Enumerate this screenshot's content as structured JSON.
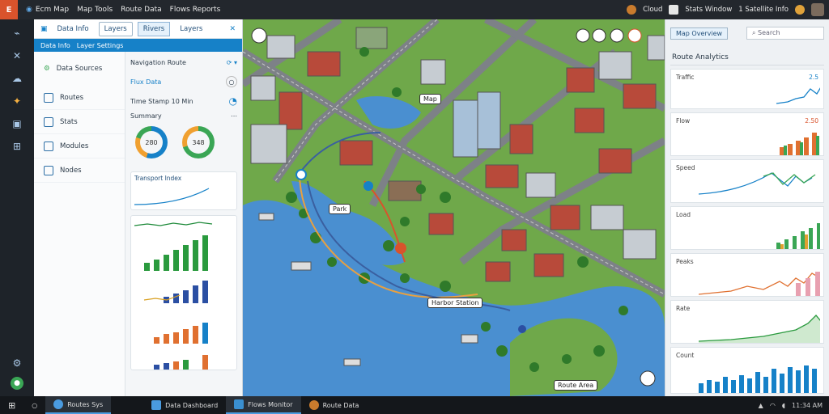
{
  "topbar": {
    "logo": "E",
    "items": [
      "Ecm Map",
      "Map Tools",
      "Route Data",
      "Flows Reports"
    ],
    "right_items": [
      "Cloud",
      "Stats Window",
      "1 Satellite Info"
    ]
  },
  "left_panel": {
    "tabs": [
      "Data Info",
      "Layers",
      "Rivers",
      "Layers"
    ],
    "bar_items": [
      "Data Info",
      "Layer Settings"
    ],
    "nav_items": [
      "Data Sources",
      "Routes",
      "Stats",
      "Modules",
      "Nodes"
    ],
    "details": {
      "header": "Navigation Route",
      "link": "Flux Data",
      "meta": "Time Stamp 10 Min",
      "summary": "Summary",
      "donut1": "280",
      "donut2": "348",
      "trend_title": "Transport Index"
    }
  },
  "map": {
    "labels": [
      "Map",
      "Park",
      "Harbor Station",
      "Route Area"
    ]
  },
  "right_panel": {
    "button": "Map Overview",
    "search_placeholder": "Search",
    "title": "Route Analytics",
    "cards": [
      {
        "label": "Traffic",
        "value": "2.5"
      },
      {
        "label": "Flow",
        "value": "2.50"
      },
      {
        "label": "Speed",
        "value": ""
      },
      {
        "label": "Load",
        "value": ""
      },
      {
        "label": "Peaks",
        "value": ""
      },
      {
        "label": "Rate",
        "value": ""
      },
      {
        "label": "Count",
        "value": ""
      }
    ]
  },
  "taskbar": {
    "tasks": [
      "Routes Sys",
      "Data Dashboard",
      "Flows Monitor",
      "Route Data"
    ],
    "tray": "11:34 AM"
  },
  "colors": {
    "accent": "#1681c8",
    "water": "#4a8fd0",
    "grass": "#6fa84a",
    "road": "#7d8187",
    "roof_red": "#b84a3a"
  }
}
